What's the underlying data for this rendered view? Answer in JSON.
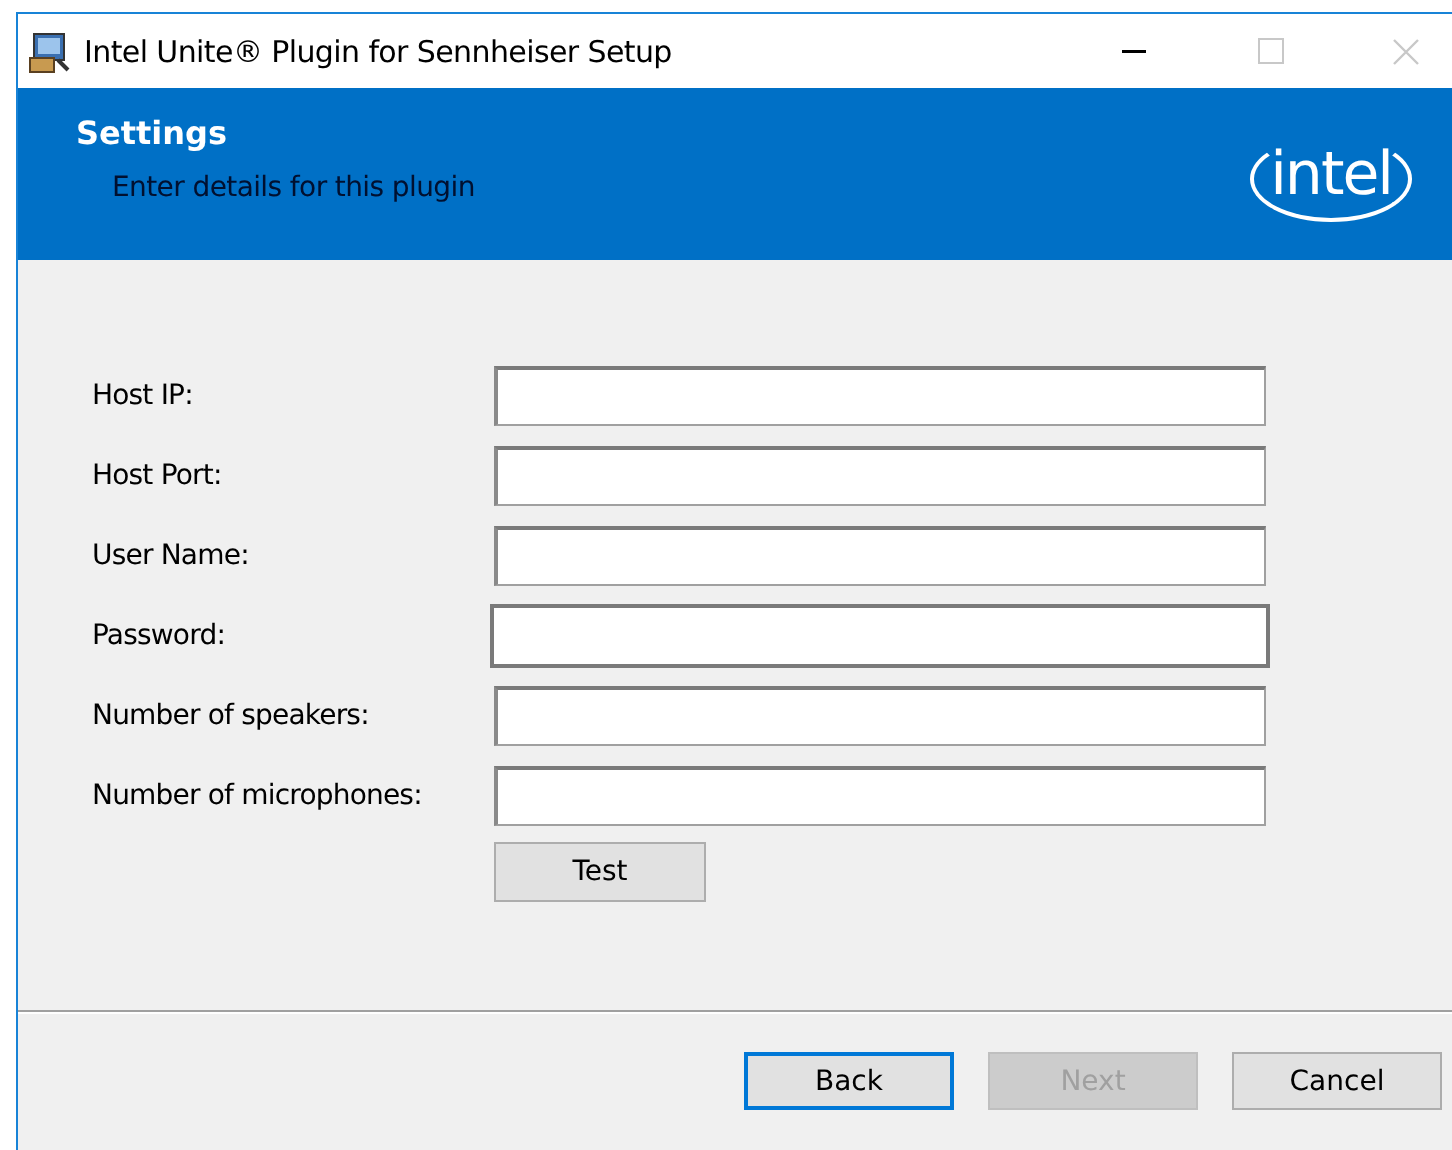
{
  "window": {
    "title": "Intel Unite® Plugin for Sennheiser Setup"
  },
  "banner": {
    "title": "Settings",
    "subtitle": "Enter details for this plugin",
    "logo": "intel"
  },
  "fields": [
    {
      "label": "Host IP:",
      "focused": false
    },
    {
      "label": "Host Port:",
      "focused": false
    },
    {
      "label": "User Name:",
      "focused": false
    },
    {
      "label": "Password:",
      "focused": true
    },
    {
      "label": "Number of speakers:",
      "focused": false
    },
    {
      "label": "Number of microphones:",
      "focused": false
    }
  ],
  "test_button": {
    "label": "Test"
  },
  "buttons": [
    {
      "label": "Back",
      "disabled": false,
      "default": true
    },
    {
      "label": "Next",
      "disabled": true,
      "default": false
    },
    {
      "label": "Cancel",
      "disabled": false,
      "default": false
    }
  ]
}
